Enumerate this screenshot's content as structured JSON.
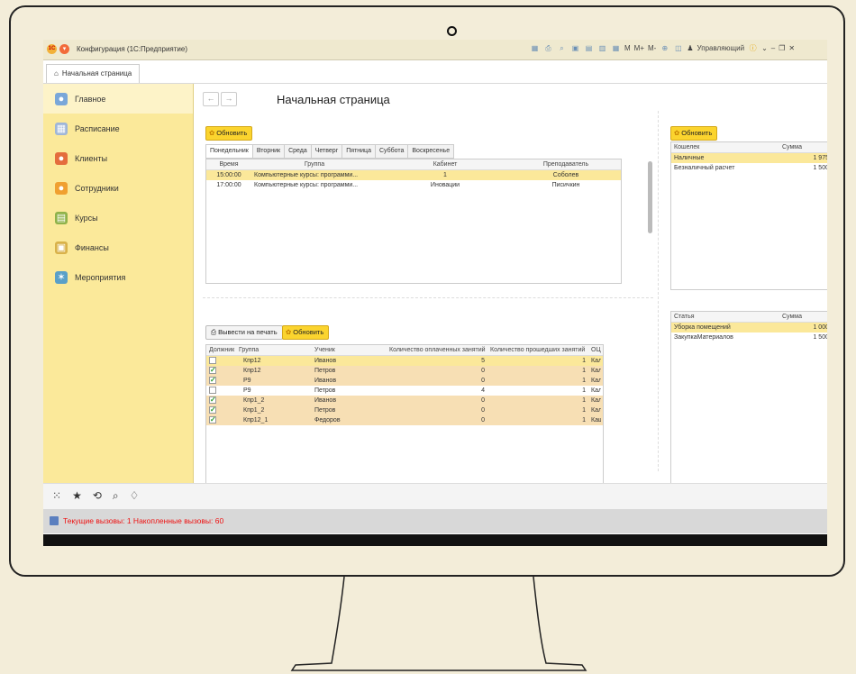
{
  "window": {
    "title": "Конфигурация (1С:Предприятие)",
    "user": "Управляющий",
    "memory_buttons": [
      "M",
      "M+",
      "M-"
    ]
  },
  "tabs": {
    "home": "Начальная страница"
  },
  "sidebar": {
    "items": [
      {
        "label": "Главное",
        "icon": "person-icon"
      },
      {
        "label": "Расписание",
        "icon": "calendar-icon"
      },
      {
        "label": "Клиенты",
        "icon": "client-icon"
      },
      {
        "label": "Сотрудники",
        "icon": "employee-icon"
      },
      {
        "label": "Курсы",
        "icon": "courses-icon"
      },
      {
        "label": "Финансы",
        "icon": "finance-icon"
      },
      {
        "label": "Мероприятия",
        "icon": "events-icon"
      }
    ]
  },
  "page": {
    "title": "Начальная страница",
    "refresh_label": "Обновить",
    "print_label": "Вывести на печать"
  },
  "schedule": {
    "days": [
      "Понедельник",
      "Вторник",
      "Среда",
      "Четверг",
      "Пятница",
      "Суббота",
      "Воскресенье"
    ],
    "columns": [
      "Время",
      "Группа",
      "Кабинет",
      "Преподаватель"
    ],
    "rows": [
      {
        "time": "15:00:00",
        "group": "Компьютерные курсы: программи...",
        "room": "1",
        "teacher": "Соболев"
      },
      {
        "time": "17:00:00",
        "group": "Компьютерные курсы: программи...",
        "room": "Иновации",
        "teacher": "Писичкин"
      }
    ]
  },
  "debtors": {
    "columns": [
      "Должник",
      "Группа",
      "Ученик",
      "Количество оплаченных занятий",
      "Количество прошедших занятий",
      "ОЦ"
    ],
    "rows": [
      {
        "debtor": false,
        "group": "Кпр12",
        "student": "Иванов",
        "paid": "5",
        "passed": "1",
        "extra": "Кал"
      },
      {
        "debtor": true,
        "group": "Кпр12",
        "student": "Петров",
        "paid": "0",
        "passed": "1",
        "extra": "Кал"
      },
      {
        "debtor": true,
        "group": "Р9",
        "student": "Иванов",
        "paid": "0",
        "passed": "1",
        "extra": "Кал"
      },
      {
        "debtor": false,
        "group": "Р9",
        "student": "Петров",
        "paid": "4",
        "passed": "1",
        "extra": "Кал"
      },
      {
        "debtor": true,
        "group": "Кпр1_2",
        "student": "Иванов",
        "paid": "0",
        "passed": "1",
        "extra": "Кал"
      },
      {
        "debtor": true,
        "group": "Кпр1_2",
        "student": "Петров",
        "paid": "0",
        "passed": "1",
        "extra": "Кал"
      },
      {
        "debtor": true,
        "group": "Кпр12_1",
        "student": "Федоров",
        "paid": "0",
        "passed": "1",
        "extra": "Каш"
      }
    ]
  },
  "wallets": {
    "columns": [
      "Кошелек",
      "Сумма"
    ],
    "rows": [
      {
        "name": "Наличные",
        "sum": "1 975"
      },
      {
        "name": "Безналичный расчет",
        "sum": "1 500"
      }
    ]
  },
  "expenses": {
    "columns": [
      "Статья",
      "Сумма"
    ],
    "rows": [
      {
        "name": "Уборка помещений",
        "sum": "1 000"
      },
      {
        "name": "ЗакупкаМатериалов",
        "sum": "1 500"
      }
    ]
  },
  "status": {
    "text": "Текущие вызовы: 1   Накопленные вызовы: 60"
  }
}
